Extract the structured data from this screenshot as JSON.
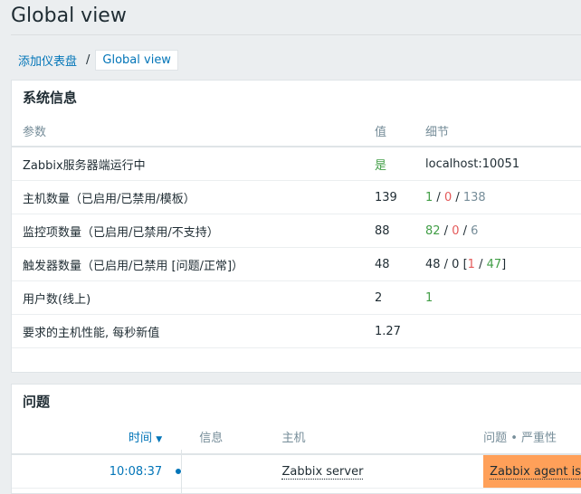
{
  "page": {
    "title": "Global view"
  },
  "breadcrumb": {
    "parent": "添加仪表盘",
    "separator": "/",
    "current": "Global view"
  },
  "system_info": {
    "title": "系统信息",
    "headers": {
      "param": "参数",
      "value": "值",
      "details": "细节"
    },
    "rows": [
      {
        "param": "Zabbix服务器端运行中",
        "value": "是",
        "details": "localhost:10051"
      },
      {
        "param": "主机数量（已启用/已禁用/模板）",
        "value": "139",
        "d1": "1",
        "s1": " / ",
        "d2": "0",
        "s2": " / ",
        "d3": "138"
      },
      {
        "param": "监控项数量（已启用/已禁用/不支持）",
        "value": "88",
        "d1": "82",
        "s1": " / ",
        "d2": "0",
        "s2": " / ",
        "d3": "6"
      },
      {
        "param": "触发器数量（已启用/已禁用 [问题/正常]）",
        "value": "48",
        "t1": "48 / 0 [",
        "t2": "1",
        "t3": " / ",
        "t4": "47",
        "t5": "]"
      },
      {
        "param": "用户数(线上)",
        "value": "2",
        "details": "1"
      },
      {
        "param": "要求的主机性能, 每秒新值",
        "value": "1.27",
        "details": ""
      }
    ]
  },
  "problems": {
    "title": "问题",
    "headers": {
      "time": "时间",
      "sort": "▼",
      "info": "信息",
      "host": "主机",
      "problem": "问题 • 严重性"
    },
    "rows": [
      {
        "time": "10:08:37",
        "info": "",
        "host": "Zabbix server",
        "problem": "Zabbix agent is"
      }
    ]
  },
  "colors": {
    "accent": "#0275b8",
    "ok": "#429e47",
    "problem": "#e45959",
    "severity_average": "#ffa059"
  }
}
